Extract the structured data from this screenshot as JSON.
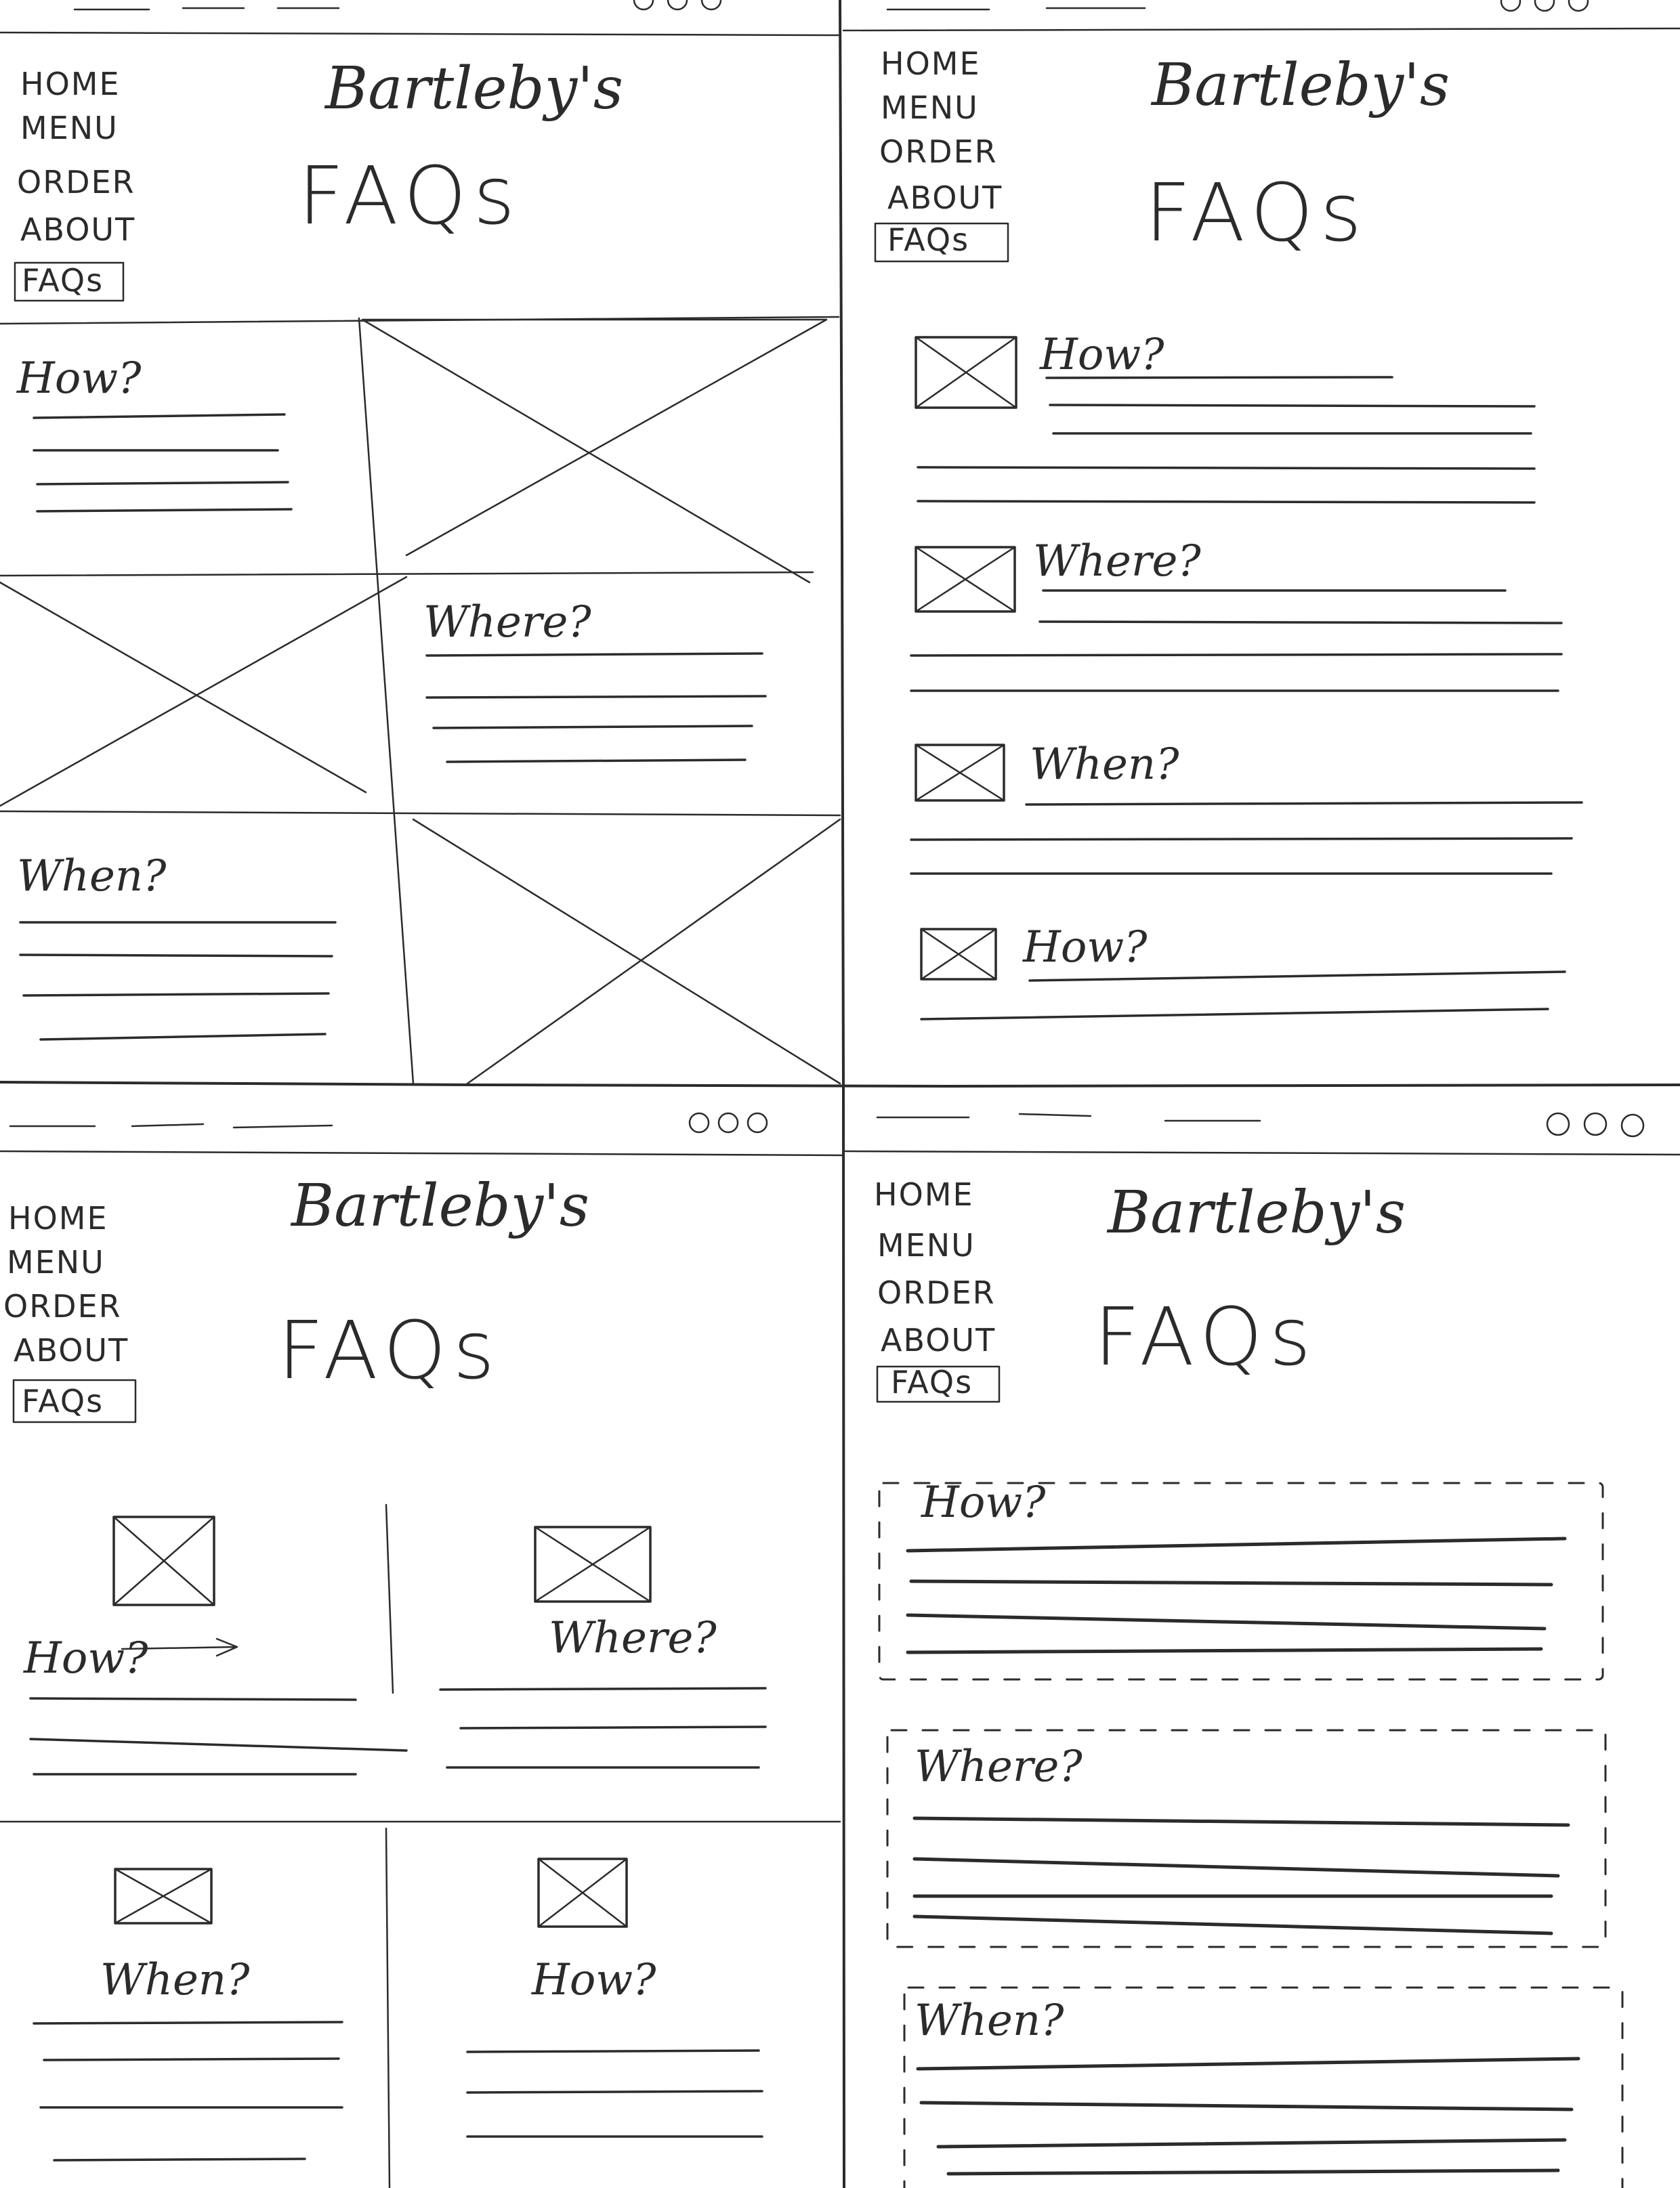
{
  "nav": {
    "home": "HOME",
    "menu": "MENU",
    "order": "ORDER",
    "about": "ABOUT",
    "faqs": "FAQs"
  },
  "brand": "Bartleby's",
  "page_title": "FAQs",
  "questions": {
    "how": "How?",
    "where": "Where?",
    "when": "When?"
  }
}
